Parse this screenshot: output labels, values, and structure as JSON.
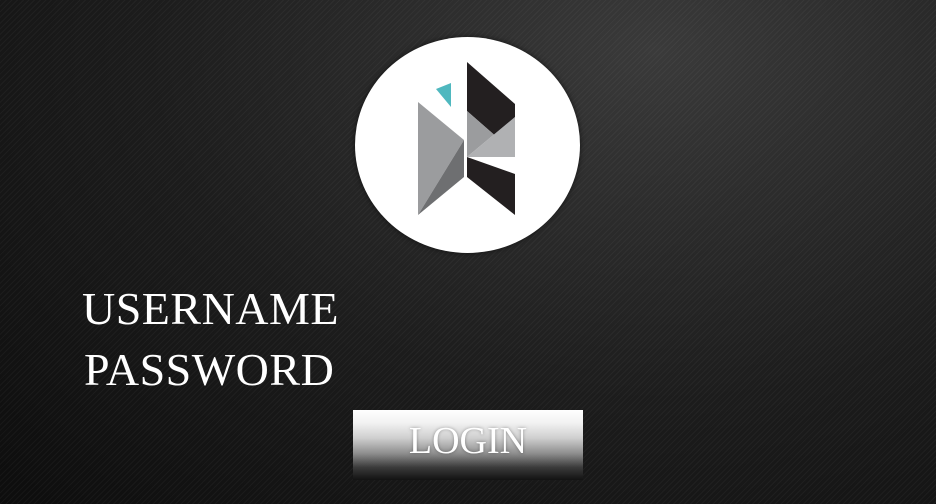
{
  "logo": {
    "icon": "geometric-r-logo",
    "colors": {
      "dark": "#231f20",
      "grey": "#9b9c9e",
      "accent": "#4fb8bf",
      "circle": "#ffffff"
    }
  },
  "form": {
    "username_label": "USERNAME",
    "password_label": "PASSWORD",
    "login_label": "LOGIN"
  }
}
